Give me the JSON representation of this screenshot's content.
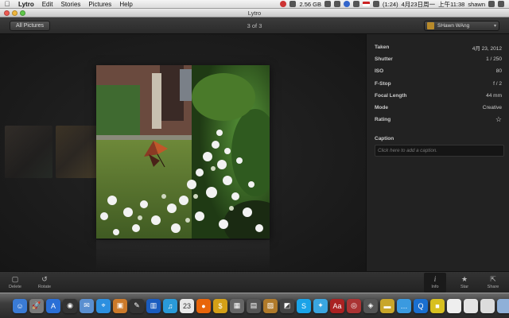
{
  "menubar": {
    "apple": "",
    "items": [
      "Lytro",
      "Edit",
      "Stories",
      "Pictures",
      "Help"
    ],
    "status": {
      "memory": "2.56 GB",
      "battery": "(1:24)",
      "date": "4月23日周一",
      "time": "上午11:38",
      "user": "shawn"
    }
  },
  "window": {
    "title": "Lytro"
  },
  "toolbar": {
    "all_pictures": "All Pictures",
    "pager": "3 of 3",
    "user_name": "SHawn WAng",
    "caret": "▾"
  },
  "info": {
    "rows": [
      {
        "label": "Taken",
        "value": "4月 23, 2012"
      },
      {
        "label": "Shutter",
        "value": "1 / 250"
      },
      {
        "label": "ISO",
        "value": "80"
      },
      {
        "label": "F-Stop",
        "value": "f / 2"
      },
      {
        "label": "Focal Length",
        "value": "44 mm"
      },
      {
        "label": "Mode",
        "value": "Creative"
      }
    ],
    "rating_label": "Rating",
    "rating_star": "☆",
    "caption_label": "Caption",
    "caption_placeholder": "Click here to add a caption."
  },
  "bottom": {
    "delete": "Delete",
    "rotate": "Rotate",
    "info": "Info",
    "star": "Star",
    "share": "Share"
  },
  "dock": {
    "icons": [
      {
        "name": "finder-icon",
        "color": "#3a7bd5",
        "glyph": "☺"
      },
      {
        "name": "launchpad-icon",
        "color": "#7a7a7a",
        "glyph": "🚀"
      },
      {
        "name": "app-store-icon",
        "color": "#2a6fd6",
        "glyph": "A"
      },
      {
        "name": "dashboard-icon",
        "color": "#333",
        "glyph": "◉"
      },
      {
        "name": "mail-icon",
        "color": "#5a8fd0",
        "glyph": "✉"
      },
      {
        "name": "safari-icon",
        "color": "#2c8fe0",
        "glyph": "⌖"
      },
      {
        "name": "preview-icon",
        "color": "#cc7a2a",
        "glyph": "▣"
      },
      {
        "name": "pen-app-icon",
        "color": "#333",
        "glyph": "✎"
      },
      {
        "name": "iphoto-icon",
        "color": "#1a5cbf",
        "glyph": "▥"
      },
      {
        "name": "itunes-icon",
        "color": "#2a9ad8",
        "glyph": "♫"
      },
      {
        "name": "calendar-icon",
        "color": "#e8e8e8",
        "glyph": "23"
      },
      {
        "name": "orange-app-icon",
        "color": "#e8650a",
        "glyph": "●"
      },
      {
        "name": "money-app-icon",
        "color": "#d4a017",
        "glyph": "$"
      },
      {
        "name": "grid-app-icon",
        "color": "#666",
        "glyph": "▦"
      },
      {
        "name": "media-app-icon",
        "color": "#555",
        "glyph": "▤"
      },
      {
        "name": "photo-app-icon",
        "color": "#b07a2a",
        "glyph": "▨"
      },
      {
        "name": "image-app-icon",
        "color": "#444",
        "glyph": "◩"
      },
      {
        "name": "skype-icon",
        "color": "#1aa3e8",
        "glyph": "S"
      },
      {
        "name": "twitter-icon",
        "color": "#3aa6e0",
        "glyph": "✦"
      },
      {
        "name": "dictionary-icon",
        "color": "#a22",
        "glyph": "Aa"
      },
      {
        "name": "photo-booth-icon",
        "color": "#a33",
        "glyph": "◎"
      },
      {
        "name": "lytro-app-icon",
        "color": "#555",
        "glyph": "◈"
      },
      {
        "name": "ruler-app-icon",
        "color": "#c8a62a",
        "glyph": "▬"
      },
      {
        "name": "messages-icon",
        "color": "#3a9ae0",
        "glyph": "…"
      },
      {
        "name": "qq-icon",
        "color": "#1a6fd0",
        "glyph": "Q"
      },
      {
        "name": "yellow-app-icon",
        "color": "#d8c020",
        "glyph": "■"
      },
      {
        "name": "document-icon",
        "color": "#eee",
        "glyph": ""
      },
      {
        "name": "document-2-icon",
        "color": "#e4e4e4",
        "glyph": ""
      },
      {
        "name": "document-3-icon",
        "color": "#dcdcdc",
        "glyph": ""
      },
      {
        "name": "folder-icon",
        "color": "#8fb0d8",
        "glyph": ""
      },
      {
        "name": "trash-icon",
        "color": "#c8c8c8",
        "glyph": "🗑"
      }
    ]
  },
  "colors": {
    "accent_panel": "#222222",
    "stage_background": "#1b1b1b"
  }
}
